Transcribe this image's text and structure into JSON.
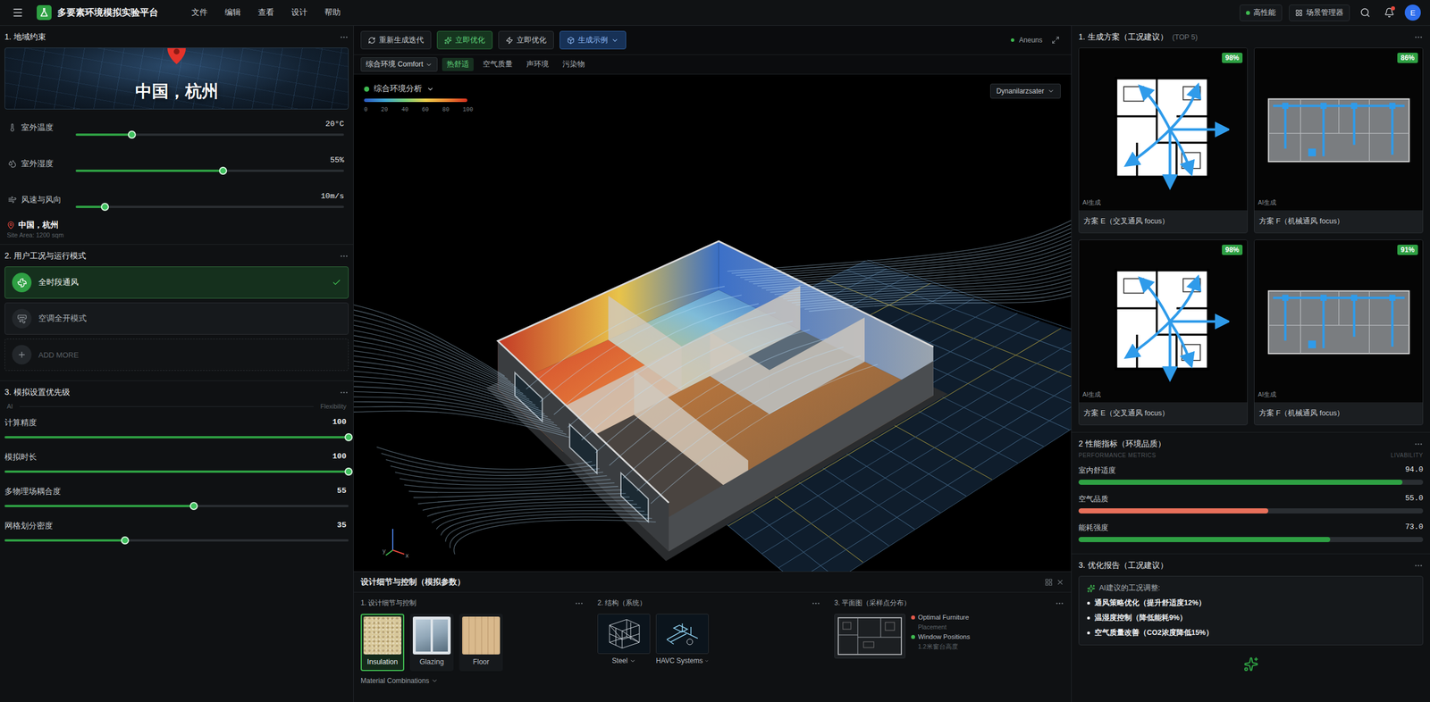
{
  "app": {
    "title": "多要素环境模拟实验平台",
    "menu": [
      "文件",
      "编辑",
      "查看",
      "设计",
      "帮助"
    ],
    "status": "高性能",
    "scene_manager": "场景管理器",
    "avatar": "E",
    "has_notifications": true
  },
  "region": {
    "title": "1. 地域约束",
    "banner": "中国，杭州",
    "sliders": [
      {
        "label": "室外温度",
        "reading": "20°C",
        "level": 0.21
      },
      {
        "label": "室外湿度",
        "reading": "55%",
        "level": 0.55
      },
      {
        "label": "风速与风向",
        "reading": "10m/s",
        "level": 0.11
      }
    ],
    "location": "中国，杭州",
    "site_area": "Site Area: 1200 sqm"
  },
  "modes": {
    "title": "2. 用户工况与运行模式",
    "items": [
      {
        "label": "全时段通风",
        "selected": true
      },
      {
        "label": "空调全开模式",
        "selected": false
      }
    ],
    "add": "ADD MORE"
  },
  "priority": {
    "title": "3. 模拟设置优先级",
    "axis_left": "AI",
    "axis_right": "Flexibility",
    "sliders": [
      {
        "label": "计算精度",
        "reading": "100",
        "level": 1
      },
      {
        "label": "模拟时长",
        "reading": "100",
        "level": 1
      },
      {
        "label": "多物理场耦合度",
        "reading": "55",
        "level": 0.55
      },
      {
        "label": "网格划分密度",
        "reading": "35",
        "level": 0.35
      }
    ]
  },
  "toolbar": {
    "buttons": [
      {
        "label": "重新生成迭代",
        "kind": "plain"
      },
      {
        "label": "立即优化",
        "kind": "primary"
      },
      {
        "label": "立即优化",
        "kind": "plain"
      },
      {
        "label": "生成示例",
        "kind": "accent"
      }
    ],
    "engine": "Aneuns"
  },
  "tabs": {
    "select": "综合环境 Comfort",
    "items": [
      {
        "label": "热舒适",
        "selected": true
      },
      {
        "label": "空气质量",
        "selected": false
      },
      {
        "label": "声环境",
        "selected": false
      },
      {
        "label": "污染物",
        "selected": false
      }
    ]
  },
  "viewport": {
    "analysis": "综合环境分析",
    "scale_ticks": [
      "0",
      "20",
      "40",
      "60",
      "80",
      "100"
    ],
    "mode_select": "Dynanilarzsater",
    "axes": [
      "y",
      "x"
    ]
  },
  "details": {
    "title": "设计细节与控制（模拟参数）",
    "materials": {
      "title": "1. 设计细节与控制",
      "items": [
        {
          "label": "Insulation",
          "kind": "texture",
          "color": "#d8c89a",
          "selected": true
        },
        {
          "label": "Glazing",
          "kind": "window",
          "color": "#8fa5b6",
          "selected": false
        },
        {
          "label": "Floor",
          "kind": "wood",
          "color": "#d9b98c",
          "selected": false
        }
      ],
      "combinations": "Material Combinations"
    },
    "structure": {
      "title": "2. 结构（系统）",
      "items": [
        {
          "label": "Steel",
          "kind": "steel"
        },
        {
          "label": "HAVC Systems",
          "kind": "hvac"
        }
      ]
    },
    "plan": {
      "title": "3. 平面图（采样点分布）",
      "legend": [
        {
          "label": "Optimal Furniture",
          "kind": "entry",
          "color": "#e0584a"
        },
        {
          "label": "Placement",
          "kind": "note"
        },
        {
          "label": "Window Positions",
          "kind": "entry",
          "color": "#3fb950"
        },
        {
          "label": "1.2米窗台高度",
          "kind": "note"
        }
      ]
    }
  },
  "scenarios": {
    "title": "1. 生成方案（工况建议）",
    "subtitle": "(TOP 5)",
    "items": [
      {
        "match": "98%",
        "tag": "AI生成",
        "name": "方案 E（交叉通风 focus）",
        "kind": "cross"
      },
      {
        "match": "86%",
        "tag": "AI生成",
        "name": "方案 F（机械通风 focus）",
        "kind": "mechanical"
      },
      {
        "match": "98%",
        "tag": "AI生成",
        "name": "方案 E（交叉通风 focus）",
        "kind": "cross"
      },
      {
        "match": "91%",
        "tag": "AI生成",
        "name": "方案 F（机械通风 focus）",
        "kind": "mechanical"
      }
    ]
  },
  "metrics": {
    "title": "2 性能指标（环境品质）",
    "left_caption": "PERFORMANCE METRICS",
    "right_caption": "LIVABILITY",
    "items": [
      {
        "label": "室内舒适度",
        "reading": "94.0",
        "level": 0.94,
        "color": "#2ea043"
      },
      {
        "label": "空气品质",
        "reading": "55.0",
        "level": 0.55,
        "color": "#e8705a"
      },
      {
        "label": "能耗强度",
        "reading": "73.0",
        "level": 0.73,
        "color": "#2ea043"
      }
    ]
  },
  "report": {
    "title": "3. 优化报告（工况建议）",
    "heading": "AI建议的工况调整:",
    "items": [
      "通风策略优化（提升舒适度12%）",
      "温湿度控制（降低能耗9%）",
      "空气质量改善（CO2浓度降低15%）"
    ]
  }
}
